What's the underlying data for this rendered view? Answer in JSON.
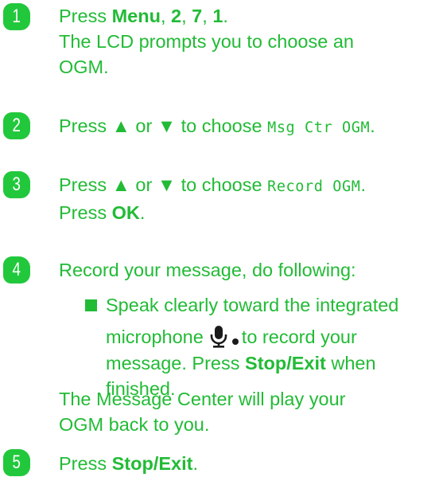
{
  "steps": [
    {
      "number": "1",
      "line1": {
        "pre": "Press ",
        "menu": "Menu",
        "sep1": ", ",
        "k2": "2",
        "sep2": ", ",
        "k7": "7",
        "sep3": ", ",
        "k1": "1",
        "end": "."
      },
      "line2": "The LCD prompts you to choose an",
      "line3": "OGM."
    },
    {
      "number": "2",
      "pre": "Press ",
      "up": "▲",
      "or": " or ",
      "down": "▼",
      "mid": " to choose ",
      "mono": "Msg Ctr OGM",
      "end": "."
    },
    {
      "number": "3",
      "pre": "Press ",
      "up": "▲",
      "or": " or ",
      "down": "▼",
      "mid": " to choose ",
      "mono": "Record OGM",
      "end": ".",
      "line2_pre": "Press ",
      "line2_bold": "OK",
      "line2_end": "."
    },
    {
      "number": "4",
      "line1": "Record your message, do following:",
      "bullet": {
        "line1": "Speak clearly toward the integrated",
        "line2_pre": "microphone",
        "line2_post": "to record your",
        "line3_pre": "message. Press ",
        "line3_bold": "Stop/Exit",
        "line3_post": " when",
        "line4": "finished."
      },
      "after1": "The Message Center will play your",
      "after2": "OGM back to you."
    },
    {
      "number": "5",
      "pre": "Press ",
      "bold": "Stop/Exit",
      "end": "."
    }
  ],
  "colors": {
    "accent": "#22bb36",
    "badge": "#22c83c"
  },
  "icons": [
    "microphone-icon",
    "bullet-square-icon",
    "dot-icon"
  ]
}
